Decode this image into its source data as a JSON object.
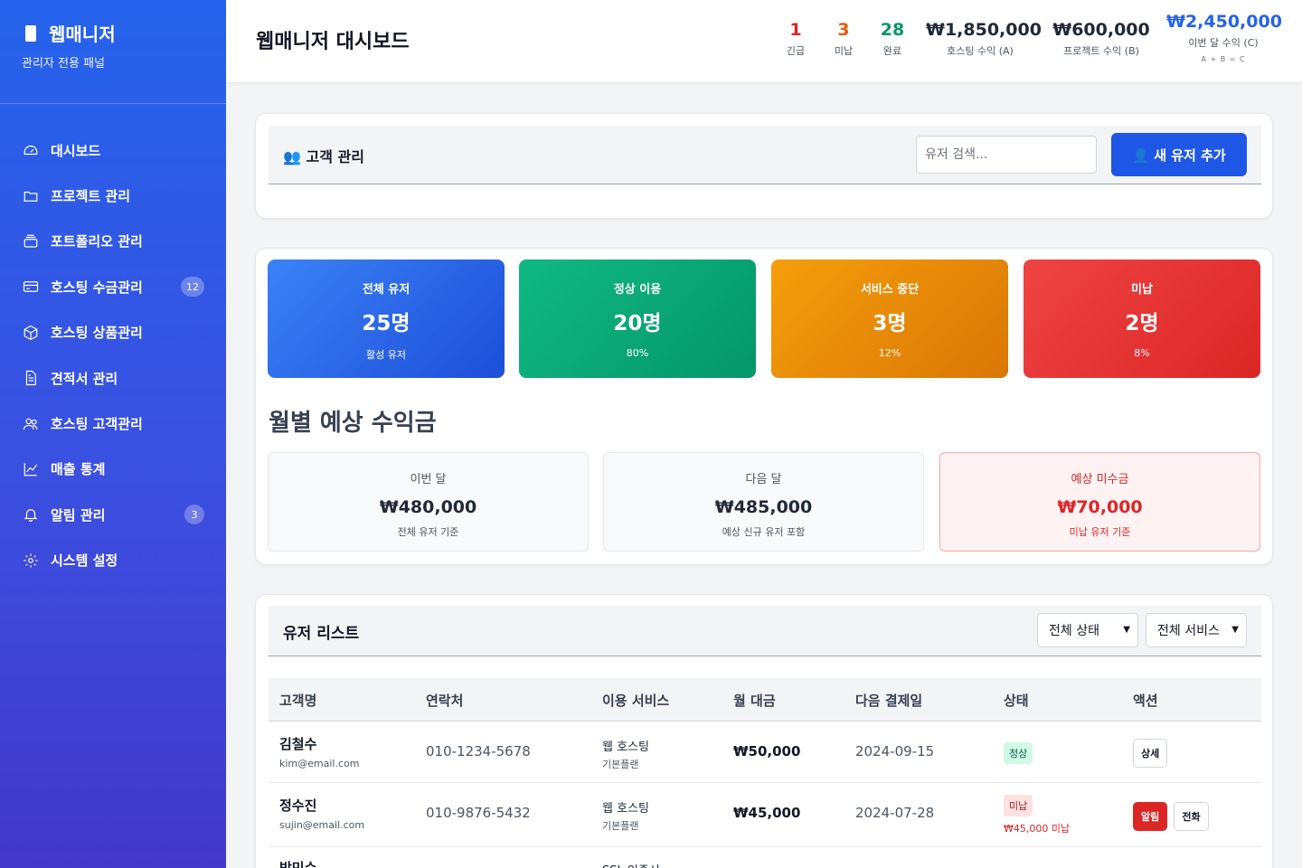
{
  "brand": {
    "title": "웹매니저",
    "subtitle": "관리자 전용 패널"
  },
  "sidebar": {
    "items": [
      {
        "label": "대시보드",
        "icon": "dashboard-icon",
        "badge": ""
      },
      {
        "label": "프로젝트 관리",
        "icon": "folder-icon",
        "badge": ""
      },
      {
        "label": "포트폴리오 관리",
        "icon": "portfolio-icon",
        "badge": ""
      },
      {
        "label": "호스팅 수금관리",
        "icon": "credit-card-icon",
        "badge": "12"
      },
      {
        "label": "호스팅 상품관리",
        "icon": "package-icon",
        "badge": ""
      },
      {
        "label": "견적서 관리",
        "icon": "document-icon",
        "badge": ""
      },
      {
        "label": "호스팅 고객관리",
        "icon": "users-icon",
        "badge": ""
      },
      {
        "label": "매출 통계",
        "icon": "chart-icon",
        "badge": ""
      },
      {
        "label": "알림 관리",
        "icon": "bell-icon",
        "badge": "3"
      },
      {
        "label": "시스템 설정",
        "icon": "gear-icon",
        "badge": ""
      }
    ]
  },
  "header": {
    "title": "웹매니저 대시보드",
    "stats": {
      "urgent": {
        "value": "1",
        "label": "긴급",
        "color": "#dc2626"
      },
      "unpaid": {
        "value": "3",
        "label": "미납",
        "color": "#ea580c"
      },
      "done": {
        "value": "28",
        "label": "완료",
        "color": "#059669"
      },
      "hosting_income": {
        "value": "₩1,850,000",
        "label": "호스팅 수익 (A)"
      },
      "project_income": {
        "value": "₩600,000",
        "label": "프로젝트 수익 (B)"
      },
      "month_income": {
        "value": "₩2,450,000",
        "label": "이번 달 수익 (C)",
        "note": "A + B = C",
        "color": "#2563eb"
      }
    }
  },
  "customers": {
    "title": "👥 고객 관리",
    "search_placeholder": "유저 검색...",
    "add_button": "👤 새 유저 추가"
  },
  "summary_cards": [
    {
      "title": "전체 유저",
      "value": "25명",
      "sub": "활성 유저",
      "color": "#2563eb"
    },
    {
      "title": "정상 이용",
      "value": "20명",
      "sub": "80%",
      "color": "#059669"
    },
    {
      "title": "서비스 중단",
      "value": "3명",
      "sub": "12%",
      "color": "#d97706"
    },
    {
      "title": "미납",
      "value": "2명",
      "sub": "8%",
      "color": "#dc2626"
    }
  ],
  "revenue": {
    "title": "월별 예상 수익금",
    "boxes": [
      {
        "label": "이번 달",
        "value": "₩480,000",
        "sub": "전체 유저 기준"
      },
      {
        "label": "다음 달",
        "value": "₩485,000",
        "sub": "예상 신규 유저 포함"
      },
      {
        "label": "예상 미수금",
        "value": "₩70,000",
        "sub": "미납 유저 기준"
      }
    ]
  },
  "user_list": {
    "title": "유저 리스트",
    "status_filter": "전체 상태",
    "service_filter": "전체 서비스",
    "columns": [
      "고객명",
      "연락처",
      "이용 서비스",
      "월 대금",
      "다음 결제일",
      "상태",
      "액션"
    ],
    "rows": [
      {
        "name": "김철수",
        "email": "kim@email.com",
        "phone": "010-1234-5678",
        "service": "웹 호스팅",
        "plan": "기본플랜",
        "fee": "₩50,000",
        "next_date": "2024-09-15",
        "status": "정상",
        "status_note": "",
        "actions": [
          "상세"
        ]
      },
      {
        "name": "정수진",
        "email": "sujin@email.com",
        "phone": "010-9876-5432",
        "service": "웹 호스팅",
        "plan": "기본플랜",
        "fee": "₩45,000",
        "next_date": "2024-07-28",
        "status": "미납",
        "status_note": "₩45,000 미납",
        "actions": [
          "알림",
          "전화"
        ]
      },
      {
        "name": "박민수",
        "service": "SSL 인증서"
      }
    ]
  }
}
